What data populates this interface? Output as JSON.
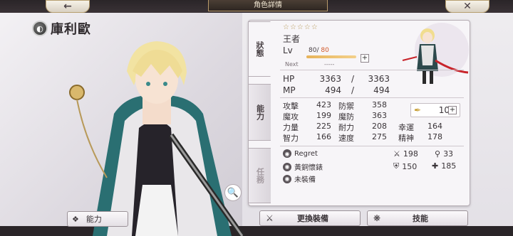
{
  "header": {
    "title": "角色詳情",
    "back_icon": "←",
    "close_icon": "✕"
  },
  "character": {
    "name": "庫利歐",
    "element_icon": "◐",
    "stars": "☆☆☆☆☆",
    "rank": "王者",
    "lv_label": "Lv",
    "lv_current": "80",
    "lv_max": "80",
    "exp_fraction": 1.0,
    "next_label": "Next",
    "next_value": "-----"
  },
  "tabs": {
    "status": "狀態",
    "ability": "能力",
    "quest": "任務"
  },
  "vitals": {
    "hp": {
      "label": "HP",
      "current": "3363",
      "sep": "/",
      "max": "3363"
    },
    "mp": {
      "label": "MP",
      "current": "494",
      "sep": "/",
      "max": "494"
    }
  },
  "stats": {
    "rows": [
      [
        {
          "k": "攻擊",
          "v": "423"
        },
        {
          "k": "防禦",
          "v": "358"
        },
        null
      ],
      [
        {
          "k": "魔攻",
          "v": "199"
        },
        {
          "k": "魔防",
          "v": "363"
        },
        null
      ],
      [
        {
          "k": "力量",
          "v": "225"
        },
        {
          "k": "耐力",
          "v": "208"
        },
        {
          "k": "幸運",
          "v": "164"
        }
      ],
      [
        {
          "k": "智力",
          "v": "166"
        },
        {
          "k": "速度",
          "v": "275"
        },
        {
          "k": "精神",
          "v": "178"
        }
      ]
    ],
    "feather_value": "10"
  },
  "equipment": {
    "items": [
      {
        "icon": "◉",
        "label": "Regret"
      },
      {
        "icon": "◉",
        "label": "黃銅懷錶"
      },
      {
        "icon": "◉",
        "label": "未裝備"
      }
    ],
    "stats": {
      "sword": "198",
      "wand": "33",
      "shield": "150",
      "armor": "185"
    }
  },
  "buttons": {
    "ability_toggle": "能力",
    "change_equip": "更換裝備",
    "skills": "技能"
  },
  "colors": {
    "accent": "#d2592a",
    "gold": "#b79a5a"
  }
}
